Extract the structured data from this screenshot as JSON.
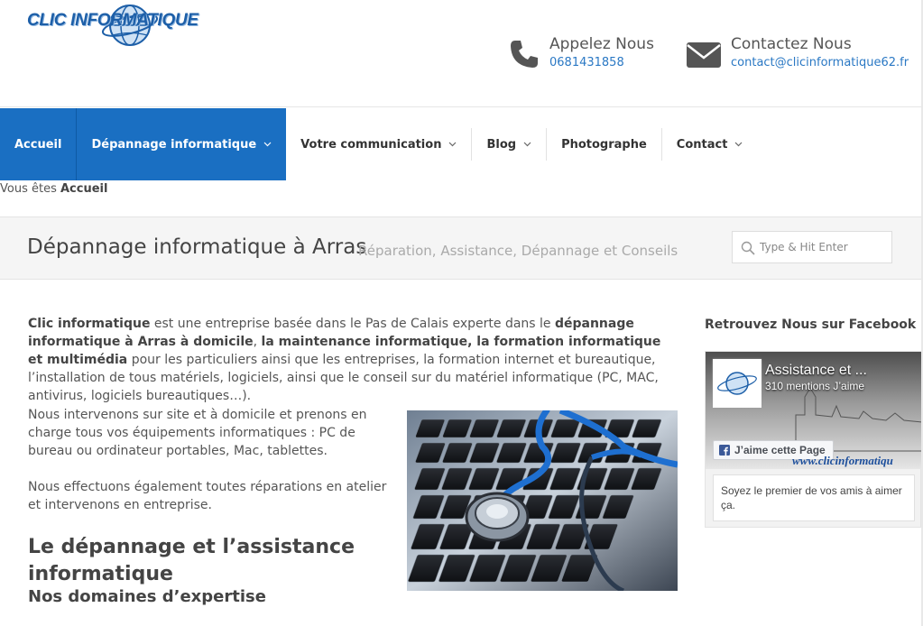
{
  "header": {
    "logo_text": "CLIC INFORMATIQUE",
    "phone": {
      "icon": "phone-icon",
      "title": "Appelez Nous",
      "value": "0681431858"
    },
    "email": {
      "icon": "envelope-icon",
      "title": "Contactez Nous",
      "value": "contact@clicinformatique62.fr"
    }
  },
  "nav": {
    "items": [
      {
        "label": "Accueil",
        "active": true
      },
      {
        "label": "Dépannage informatique",
        "active": true,
        "dropdown": true
      },
      {
        "label": "Votre communication",
        "dropdown": true
      },
      {
        "label": "Blog",
        "dropdown": true
      },
      {
        "label": "Photographe"
      },
      {
        "label": "Contact",
        "dropdown": true
      }
    ]
  },
  "breadcrumb": {
    "prefix": "Vous êtes",
    "current": "Accueil"
  },
  "titlebar": {
    "title": "Dépannage informatique à Arras",
    "subtitle": "Réparation, Assistance, Dépannage et Conseils",
    "search_placeholder": "Type & Hit Enter"
  },
  "content": {
    "intro": {
      "b1": "Clic informatique",
      "t1": " est une entreprise basée dans le Pas de Calais experte  dans le ",
      "b2": "dépannage informatique à Arras à domicile",
      "t2": ", ",
      "b3": "la maintenance informatique, la formation informatique et multimédia",
      "t3": " pour les particuliers ainsi que les entreprises, la formation internet et bureautique, l’installation de tous matériels, logiciels, ainsi que le conseil sur du matériel informatique (PC, MAC, antivirus, logiciels bureautiques…)."
    },
    "para2": "Nous intervenons sur site et à domicile et prenons en charge tous vos équipements informatiques : PC de bureau ou ordinateur portables, Mac, tablettes.",
    "para3": "Nous effectuons également toutes réparations en atelier et intervenons en entreprise.",
    "heading_assist": "Le dépannage et l’assistance informatique",
    "heading_domaines": "Nos domaines d’expertise"
  },
  "sidebar": {
    "heading": "Retrouvez Nous sur Facebook",
    "fb": {
      "page_name": "Assistance et ...",
      "likes": "310 mentions J’aime",
      "like_button": "J’aime cette Page",
      "cover_text": "www.clicinformatiqu",
      "friends_text": "Soyez le premier de vos amis à aimer ça."
    }
  },
  "colors": {
    "accent": "#1a6fc2",
    "link": "#2a78c4"
  }
}
